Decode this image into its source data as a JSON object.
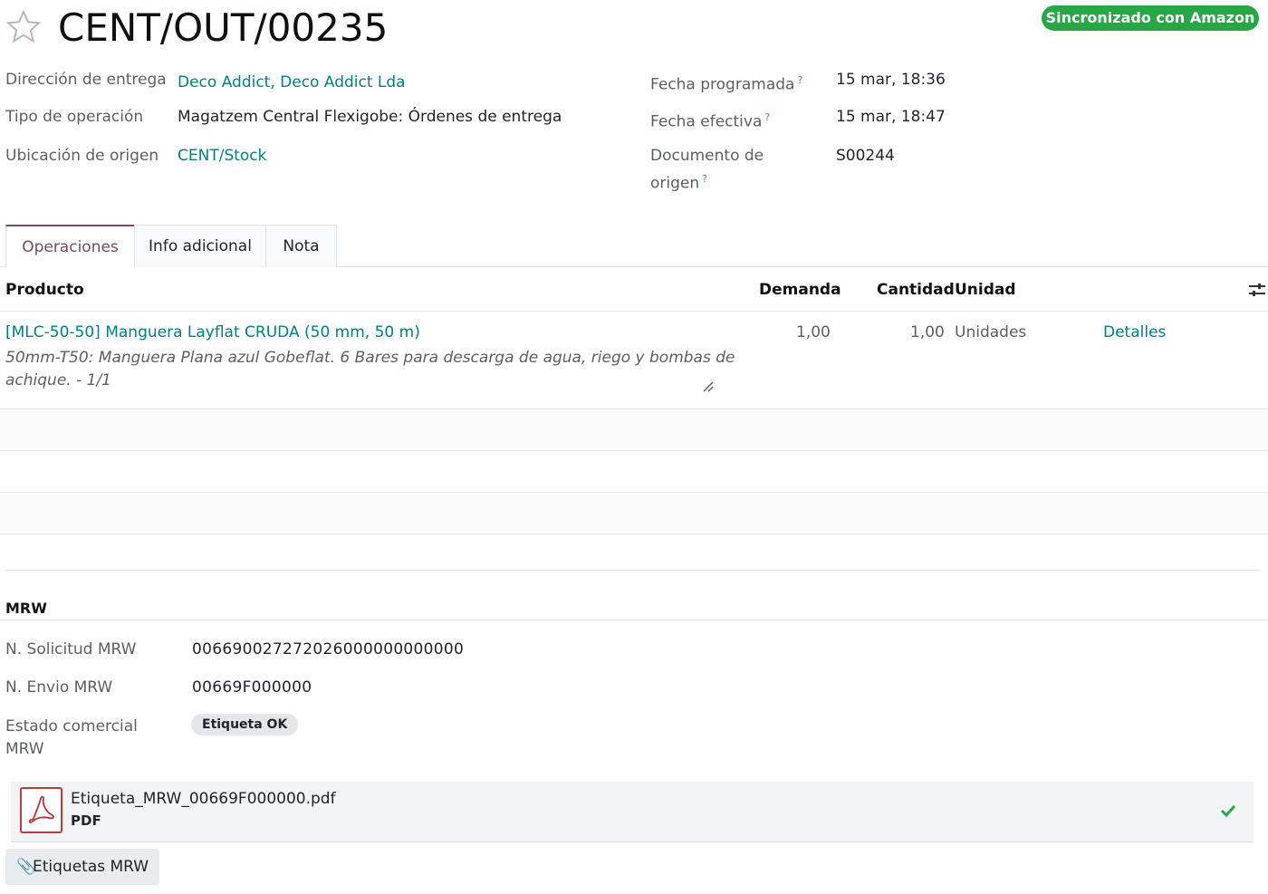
{
  "header": {
    "title": "CENT/OUT/00235",
    "badge": "Sincronizado con Amazon",
    "star_icon": "star-outline-icon"
  },
  "fields_left": [
    {
      "label": "Dirección de entrega",
      "value": "Deco Addict, Deco Addict Lda"
    },
    {
      "label": "Tipo de operación",
      "value": "Magatzem Central Flexigobe: Órdenes de entrega"
    },
    {
      "label": "Ubicación de origen",
      "value": "CENT/Stock"
    }
  ],
  "fields_right": [
    {
      "label": "Fecha programada",
      "help": "?",
      "value": "15 mar, 18:36"
    },
    {
      "label": "Fecha efectiva",
      "help": "?",
      "value": "15 mar, 18:47"
    },
    {
      "label_line1": "Documento de",
      "label_line2": "origen",
      "help": "?",
      "value": "S00244"
    }
  ],
  "tabs": [
    {
      "label": "Operaciones"
    },
    {
      "label": "Info adicional"
    },
    {
      "label": "Nota"
    }
  ],
  "table": {
    "headers": {
      "producto": "Producto",
      "demanda": "Demanda",
      "cantidad": "Cantidad",
      "unidad": "Unidad"
    },
    "rows": [
      {
        "product": "[MLC-50-50] Manguera Layflat CRUDA (50 mm, 50 m)",
        "desc_line1": "50mm-T50: Manguera Plana azul Gobeflat. 6 Bares para descarga de agua, riego y bombas de",
        "desc_line2": "achique. - 1/1",
        "demanda": "1,00",
        "cantidad": "1,00",
        "unidad": "Unidades",
        "action": "Detalles"
      }
    ]
  },
  "mrw": {
    "section_title": "MRW",
    "fields": [
      {
        "label": "N. Solicitud MRW",
        "value": "006690027272026000000000000"
      },
      {
        "label": "N. Envio MRW",
        "value": "00669F000000"
      }
    ],
    "estado_label_line1": "Estado comercial",
    "estado_label_line2": "MRW",
    "estado_value": "Etiqueta OK",
    "attachment": {
      "name": "Etiqueta_MRW_00669F000000.pdf",
      "type": "PDF"
    },
    "button_label": "Etiquetas MRW"
  },
  "colors": {
    "brand": "#714b67",
    "link": "#017e84",
    "badge": "#28a745",
    "check": "#28a745"
  }
}
